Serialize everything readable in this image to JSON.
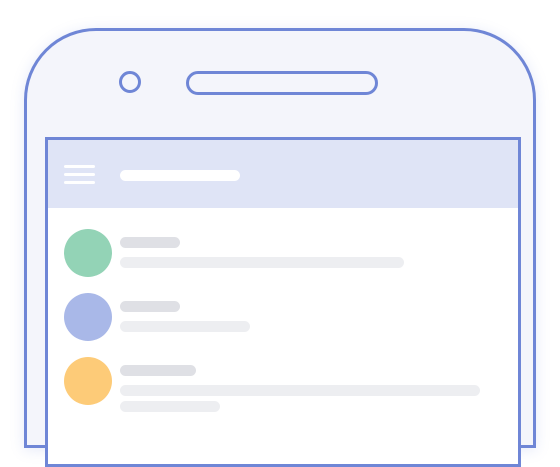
{
  "colors": {
    "accent": "#6f86d6",
    "device_fill": "#f4f5fb",
    "appbar": "#dfe4f6",
    "placeholder_title": "#dfe0e5",
    "placeholder_sub": "#edeef1"
  },
  "appbar": {
    "menu_icon": "hamburger-menu-icon",
    "title_placeholder": true
  },
  "list": {
    "items": [
      {
        "avatar_color": "#93d3b6",
        "placeholder_lines": 2
      },
      {
        "avatar_color": "#a9b8e8",
        "placeholder_lines": 2
      },
      {
        "avatar_color": "#fdcb78",
        "placeholder_lines": 3
      }
    ]
  }
}
